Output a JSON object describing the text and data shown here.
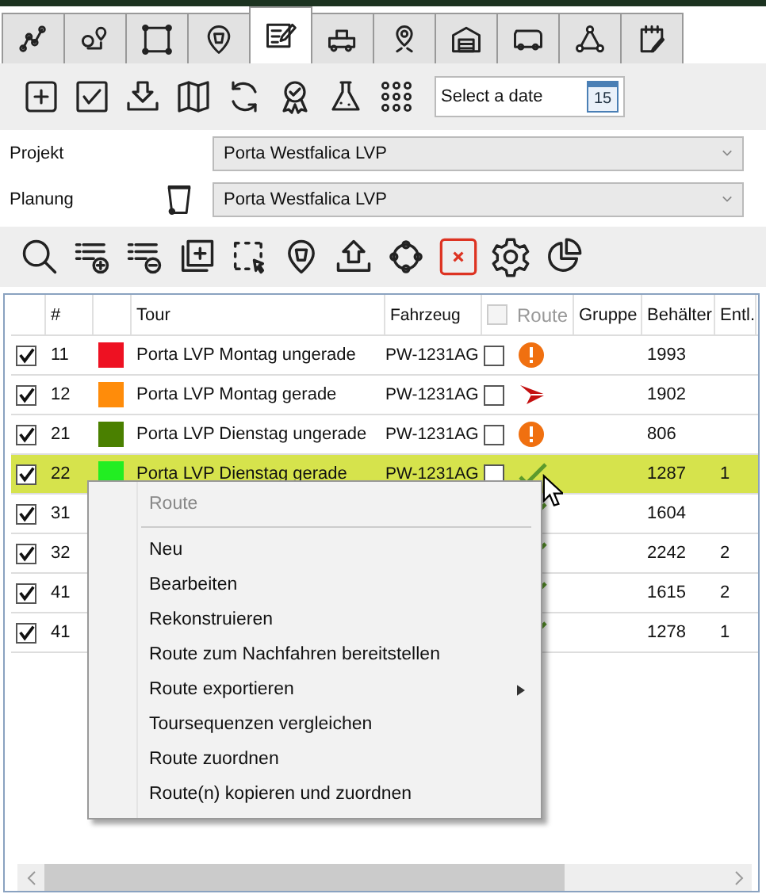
{
  "tabs": [
    {
      "selected": false
    },
    {
      "selected": false
    },
    {
      "selected": false
    },
    {
      "selected": false
    },
    {
      "selected": true
    },
    {
      "selected": false
    },
    {
      "selected": false
    },
    {
      "selected": false
    },
    {
      "selected": false
    },
    {
      "selected": false
    },
    {
      "selected": false
    }
  ],
  "toolbar": {
    "date_field": {
      "placeholder": "Select a date"
    },
    "calendar_day": "15"
  },
  "projekt": {
    "label": "Projekt",
    "value": "Porta Westfalica LVP"
  },
  "planung": {
    "label": "Planung",
    "value": "Porta Westfalica LVP"
  },
  "table": {
    "header": {
      "number": "#",
      "tour": "Tour",
      "vehicle": "Fahrzeug",
      "route": "Route",
      "route_checked": false,
      "gruppe": "Gruppe",
      "behaelter": "Behälter",
      "entl": "Entl."
    },
    "rows": [
      {
        "checked": true,
        "number": "11",
        "color": "#ee1122",
        "tour": "Porta LVP Montag ungerade",
        "vehicle": "PW-1231AG",
        "route_checked": false,
        "route": {
          "kind": "warning"
        },
        "behaelter": "1993",
        "selected": false
      },
      {
        "checked": true,
        "number": "12",
        "color": "#ff8c0a",
        "tour": "Porta LVP Montag gerade",
        "vehicle": "PW-1231AG",
        "route_checked": false,
        "route": {
          "kind": "sent"
        },
        "behaelter": "1902",
        "selected": false
      },
      {
        "checked": true,
        "number": "21",
        "color": "#4a8000",
        "tour": "Porta LVP Dienstag ungerade",
        "vehicle": "PW-1231AG",
        "route_checked": false,
        "route": {
          "kind": "warning"
        },
        "behaelter": "806",
        "selected": false
      },
      {
        "checked": true,
        "number": "22",
        "color": "#22ee22",
        "tour": "Porta LVP Dienstag gerade",
        "vehicle": "PW-1231AG",
        "route_checked": false,
        "route": {
          "kind": "ok"
        },
        "behaelter": "1287",
        "entl": "1",
        "selected": true
      },
      {
        "checked": true,
        "number": "31",
        "route": {
          "kind": "ok"
        },
        "behaelter": "1604",
        "selected": false
      },
      {
        "checked": true,
        "number": "32",
        "route": {
          "kind": "ok"
        },
        "behaelter": "2242",
        "entl": "2",
        "selected": false
      },
      {
        "checked": true,
        "number": "41",
        "route": {
          "kind": "ok"
        },
        "behaelter": "1615",
        "entl": "2",
        "selected": false
      },
      {
        "checked": true,
        "number": "41",
        "route": {
          "kind": "ok"
        },
        "behaelter": "1278",
        "entl": "1",
        "selected": false
      }
    ]
  },
  "context_menu": {
    "title": "Route",
    "items": [
      {
        "label": "Neu",
        "submenu": false
      },
      {
        "label": "Bearbeiten",
        "submenu": false
      },
      {
        "label": "Rekonstruieren",
        "submenu": false
      },
      {
        "label": "Route zum Nachfahren bereitstellen",
        "submenu": false
      },
      {
        "label": "Route exportieren",
        "submenu": true
      },
      {
        "label": "Toursequenzen vergleichen",
        "submenu": false
      },
      {
        "label": "Route zuordnen",
        "submenu": false
      },
      {
        "label": "Route(n) kopieren und zuordnen",
        "submenu": false
      }
    ]
  }
}
